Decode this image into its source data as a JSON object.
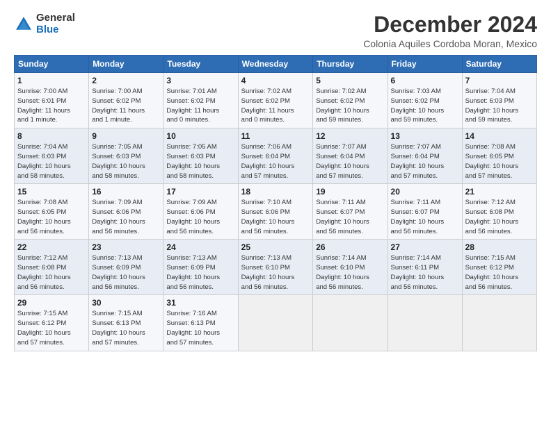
{
  "logo": {
    "general": "General",
    "blue": "Blue"
  },
  "title": "December 2024",
  "subtitle": "Colonia Aquiles Cordoba Moran, Mexico",
  "headers": [
    "Sunday",
    "Monday",
    "Tuesday",
    "Wednesday",
    "Thursday",
    "Friday",
    "Saturday"
  ],
  "weeks": [
    [
      {
        "num": "1",
        "info": "Sunrise: 7:00 AM\nSunset: 6:01 PM\nDaylight: 11 hours\nand 1 minute."
      },
      {
        "num": "2",
        "info": "Sunrise: 7:00 AM\nSunset: 6:02 PM\nDaylight: 11 hours\nand 1 minute."
      },
      {
        "num": "3",
        "info": "Sunrise: 7:01 AM\nSunset: 6:02 PM\nDaylight: 11 hours\nand 0 minutes."
      },
      {
        "num": "4",
        "info": "Sunrise: 7:02 AM\nSunset: 6:02 PM\nDaylight: 11 hours\nand 0 minutes."
      },
      {
        "num": "5",
        "info": "Sunrise: 7:02 AM\nSunset: 6:02 PM\nDaylight: 10 hours\nand 59 minutes."
      },
      {
        "num": "6",
        "info": "Sunrise: 7:03 AM\nSunset: 6:02 PM\nDaylight: 10 hours\nand 59 minutes."
      },
      {
        "num": "7",
        "info": "Sunrise: 7:04 AM\nSunset: 6:03 PM\nDaylight: 10 hours\nand 59 minutes."
      }
    ],
    [
      {
        "num": "8",
        "info": "Sunrise: 7:04 AM\nSunset: 6:03 PM\nDaylight: 10 hours\nand 58 minutes."
      },
      {
        "num": "9",
        "info": "Sunrise: 7:05 AM\nSunset: 6:03 PM\nDaylight: 10 hours\nand 58 minutes."
      },
      {
        "num": "10",
        "info": "Sunrise: 7:05 AM\nSunset: 6:03 PM\nDaylight: 10 hours\nand 58 minutes."
      },
      {
        "num": "11",
        "info": "Sunrise: 7:06 AM\nSunset: 6:04 PM\nDaylight: 10 hours\nand 57 minutes."
      },
      {
        "num": "12",
        "info": "Sunrise: 7:07 AM\nSunset: 6:04 PM\nDaylight: 10 hours\nand 57 minutes."
      },
      {
        "num": "13",
        "info": "Sunrise: 7:07 AM\nSunset: 6:04 PM\nDaylight: 10 hours\nand 57 minutes."
      },
      {
        "num": "14",
        "info": "Sunrise: 7:08 AM\nSunset: 6:05 PM\nDaylight: 10 hours\nand 57 minutes."
      }
    ],
    [
      {
        "num": "15",
        "info": "Sunrise: 7:08 AM\nSunset: 6:05 PM\nDaylight: 10 hours\nand 56 minutes."
      },
      {
        "num": "16",
        "info": "Sunrise: 7:09 AM\nSunset: 6:06 PM\nDaylight: 10 hours\nand 56 minutes."
      },
      {
        "num": "17",
        "info": "Sunrise: 7:09 AM\nSunset: 6:06 PM\nDaylight: 10 hours\nand 56 minutes."
      },
      {
        "num": "18",
        "info": "Sunrise: 7:10 AM\nSunset: 6:06 PM\nDaylight: 10 hours\nand 56 minutes."
      },
      {
        "num": "19",
        "info": "Sunrise: 7:11 AM\nSunset: 6:07 PM\nDaylight: 10 hours\nand 56 minutes."
      },
      {
        "num": "20",
        "info": "Sunrise: 7:11 AM\nSunset: 6:07 PM\nDaylight: 10 hours\nand 56 minutes."
      },
      {
        "num": "21",
        "info": "Sunrise: 7:12 AM\nSunset: 6:08 PM\nDaylight: 10 hours\nand 56 minutes."
      }
    ],
    [
      {
        "num": "22",
        "info": "Sunrise: 7:12 AM\nSunset: 6:08 PM\nDaylight: 10 hours\nand 56 minutes."
      },
      {
        "num": "23",
        "info": "Sunrise: 7:13 AM\nSunset: 6:09 PM\nDaylight: 10 hours\nand 56 minutes."
      },
      {
        "num": "24",
        "info": "Sunrise: 7:13 AM\nSunset: 6:09 PM\nDaylight: 10 hours\nand 56 minutes."
      },
      {
        "num": "25",
        "info": "Sunrise: 7:13 AM\nSunset: 6:10 PM\nDaylight: 10 hours\nand 56 minutes."
      },
      {
        "num": "26",
        "info": "Sunrise: 7:14 AM\nSunset: 6:10 PM\nDaylight: 10 hours\nand 56 minutes."
      },
      {
        "num": "27",
        "info": "Sunrise: 7:14 AM\nSunset: 6:11 PM\nDaylight: 10 hours\nand 56 minutes."
      },
      {
        "num": "28",
        "info": "Sunrise: 7:15 AM\nSunset: 6:12 PM\nDaylight: 10 hours\nand 56 minutes."
      }
    ],
    [
      {
        "num": "29",
        "info": "Sunrise: 7:15 AM\nSunset: 6:12 PM\nDaylight: 10 hours\nand 57 minutes."
      },
      {
        "num": "30",
        "info": "Sunrise: 7:15 AM\nSunset: 6:13 PM\nDaylight: 10 hours\nand 57 minutes."
      },
      {
        "num": "31",
        "info": "Sunrise: 7:16 AM\nSunset: 6:13 PM\nDaylight: 10 hours\nand 57 minutes."
      },
      null,
      null,
      null,
      null
    ]
  ]
}
